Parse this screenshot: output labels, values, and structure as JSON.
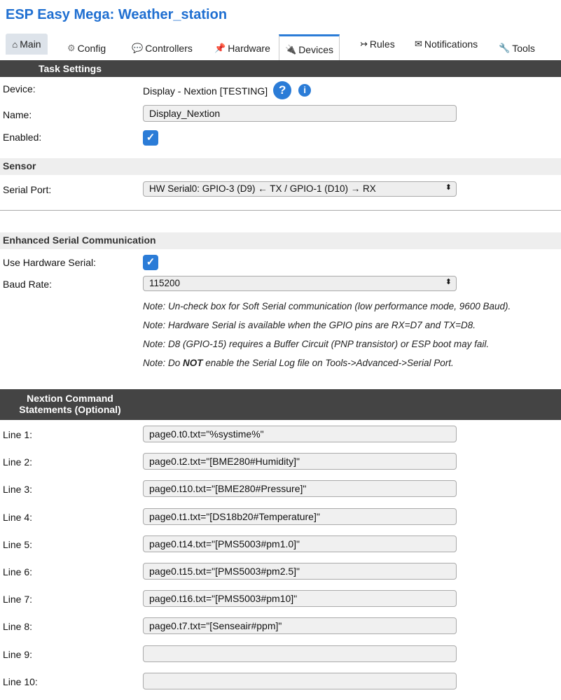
{
  "app_title": "ESP Easy Mega: Weather_station",
  "tabs": [
    {
      "icon": "⌂",
      "label": "Main"
    },
    {
      "icon": "⚙",
      "label": "Config"
    },
    {
      "icon": "💬",
      "label": "Controllers"
    },
    {
      "icon": "📌",
      "label": "Hardware"
    },
    {
      "icon": "🔌",
      "label": "Devices"
    },
    {
      "icon": "↣",
      "label": "Rules"
    },
    {
      "icon": "✉",
      "label": "Notifications"
    },
    {
      "icon": "🔧",
      "label": "Tools"
    }
  ],
  "task_settings": {
    "header": "Task Settings",
    "device_label": "Device:",
    "device_value": "Display - Nextion [TESTING]",
    "help_icon": "?",
    "info_icon": "i",
    "name_label": "Name:",
    "name_value": "Display_Nextion",
    "enabled_label": "Enabled:",
    "enabled_checked": true
  },
  "sensor": {
    "header": "Sensor",
    "serial_label": "Serial Port:",
    "serial_value": "HW Serial0: GPIO-3 (D9) ← TX / GPIO-1 (D10) → RX"
  },
  "enhanced": {
    "header": "Enhanced Serial Communication",
    "use_hw_label": "Use Hardware Serial:",
    "use_hw_checked": true,
    "baud_label": "Baud Rate:",
    "baud_value": "115200",
    "note1": "Note: Un-check box for Soft Serial communication (low performance mode, 9600 Baud).",
    "note2": "Note: Hardware Serial is available when the GPIO pins are RX=D7 and TX=D8.",
    "note3": "Note: D8 (GPIO-15) requires a Buffer Circuit (PNP transistor) or ESP boot may fail.",
    "note4_pre": "Note: Do ",
    "note4_bold": "NOT",
    "note4_post": " enable the Serial Log file on Tools->Advanced->Serial Port."
  },
  "nextion": {
    "header_line1": "Nextion Command",
    "header_line2": "Statements (Optional)",
    "lines": [
      {
        "label": "Line 1:",
        "value": "page0.t0.txt=\"%systime%\""
      },
      {
        "label": "Line 2:",
        "value": "page0.t2.txt=\"[BME280#Humidity]\""
      },
      {
        "label": "Line 3:",
        "value": "page0.t10.txt=\"[BME280#Pressure]\""
      },
      {
        "label": "Line 4:",
        "value": "page0.t1.txt=\"[DS18b20#Temperature]\""
      },
      {
        "label": "Line 5:",
        "value": "page0.t14.txt=\"[PMS5003#pm1.0]\""
      },
      {
        "label": "Line 6:",
        "value": "page0.t15.txt=\"[PMS5003#pm2.5]\""
      },
      {
        "label": "Line 7:",
        "value": "page0.t16.txt=\"[PMS5003#pm10]\""
      },
      {
        "label": "Line 8:",
        "value": "page0.t7.txt=\"[Senseair#ppm]\""
      },
      {
        "label": "Line 9:",
        "value": ""
      },
      {
        "label": "Line 10:",
        "value": ""
      }
    ]
  },
  "colors": {
    "accent": "#2b7cd7",
    "header_bg": "#444444",
    "title": "#1f6fd1"
  }
}
